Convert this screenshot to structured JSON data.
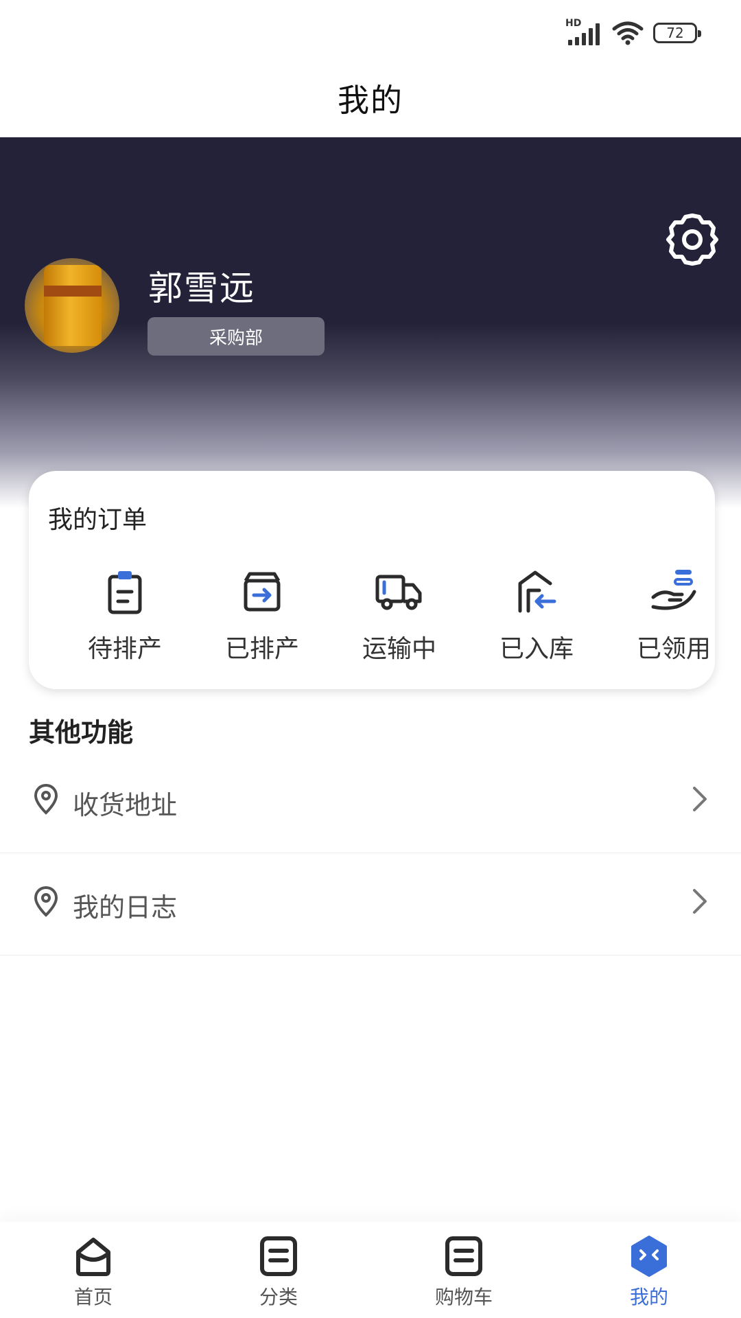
{
  "status_bar": {
    "network": "HD",
    "battery": "72"
  },
  "header": {
    "title": "我的"
  },
  "profile": {
    "name": "郭雪远",
    "department": "采购部"
  },
  "orders": {
    "title": "我的订单",
    "items": [
      {
        "label": "待排产",
        "icon": "clipboard-icon"
      },
      {
        "label": "已排产",
        "icon": "box-arrow-icon"
      },
      {
        "label": "运输中",
        "icon": "truck-icon"
      },
      {
        "label": "已入库",
        "icon": "warehouse-icon"
      },
      {
        "label": "已领用",
        "icon": "hand-receive-icon"
      }
    ]
  },
  "other": {
    "title": "其他功能",
    "items": [
      {
        "label": "收货地址",
        "icon": "location-pin-icon"
      },
      {
        "label": "我的日志",
        "icon": "location-pin-icon"
      }
    ]
  },
  "tabs": [
    {
      "label": "首页",
      "icon": "home-icon"
    },
    {
      "label": "分类",
      "icon": "category-icon"
    },
    {
      "label": "购物车",
      "icon": "cart-icon"
    },
    {
      "label": "我的",
      "icon": "profile-icon",
      "active": true
    }
  ],
  "colors": {
    "header_bg": "#232238",
    "accent": "#3a6ed8",
    "badge_bg": "#6e6d7e"
  }
}
